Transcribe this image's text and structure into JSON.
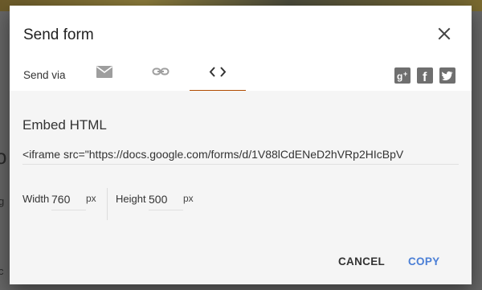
{
  "background": {
    "fragment_big": "o",
    "fragment_small_1": "g",
    "fragment_small_2": "c"
  },
  "dialog": {
    "title": "Send form",
    "close_icon": "close-icon",
    "send_via_label": "Send via",
    "tabs": [
      {
        "name": "email",
        "icon": "email-icon",
        "active": false
      },
      {
        "name": "link",
        "icon": "link-icon",
        "active": false
      },
      {
        "name": "embed",
        "icon": "code-icon",
        "active": true
      }
    ],
    "social": [
      {
        "name": "google-plus",
        "icon": "google-plus-icon",
        "glyph": "g+"
      },
      {
        "name": "facebook",
        "icon": "facebook-icon",
        "glyph": "f"
      },
      {
        "name": "twitter",
        "icon": "twitter-icon"
      }
    ],
    "embed": {
      "heading": "Embed HTML",
      "code": "<iframe src=\"https://docs.google.com/forms/d/1V88lCdENeD2hVRp2HIcBpV",
      "width_label": "Width",
      "width_value": "760",
      "width_unit": "px",
      "height_label": "Height",
      "height_value": "500",
      "height_unit": "px"
    },
    "buttons": {
      "cancel": "CANCEL",
      "copy": "COPY"
    }
  },
  "colors": {
    "accent_tab": "#b14b00",
    "copy_button": "#4b7fd6",
    "overlay": "#5a5a5a",
    "body_bg": "#f5f5f5"
  }
}
